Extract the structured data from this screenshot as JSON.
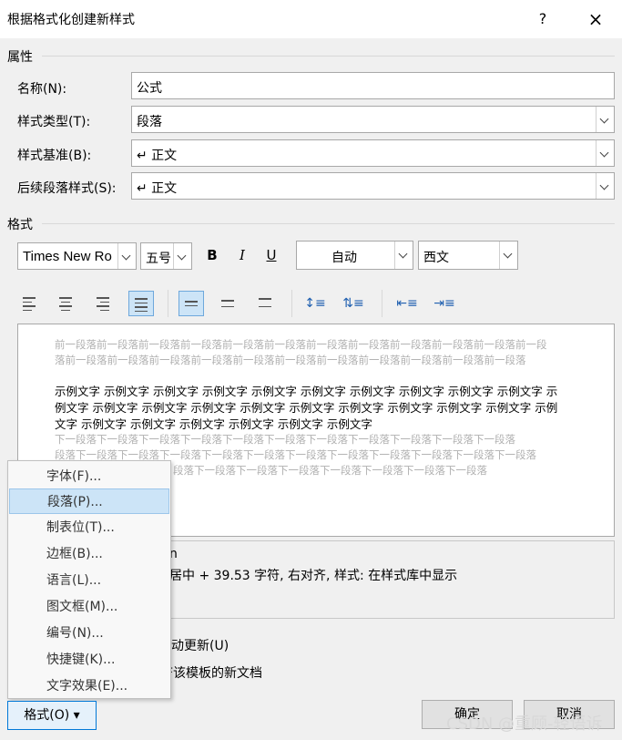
{
  "window": {
    "title": "根据格式化创建新样式",
    "help": "?",
    "close": "×"
  },
  "properties": {
    "section": "属性",
    "name_label": "名称(N):",
    "name_value": "公式",
    "type_label": "样式类型(T):",
    "type_value": "段落",
    "based_label": "样式基准(B):",
    "based_value": "↵ 正文",
    "next_label": "后续段落样式(S):",
    "next_value": "↵ 正文"
  },
  "format": {
    "section": "格式",
    "font": "Times New Ro",
    "size": "五号",
    "bold": "B",
    "italic": "I",
    "underline": "U",
    "color": "自动",
    "script": "西文"
  },
  "preview": {
    "prev_text": "前一段落前一段落前一段落前一段落前一段落前一段落前一段落前一段落前一段落前一段落前一段落前一段落前一段落前一段落前一段落前一段落前一段落前一段落前一段落前一段落前一段落前一段落前一段落",
    "sample_text": "示例文字 示例文字 示例文字 示例文字 示例文字 示例文字 示例文字 示例文字 示例文字 示例文字 示例文字 示例文字 示例文字 示例文字 示例文字 示例文字 示例文字 示例文字 示例文字 示例文字 示例文字 示例文字 示例文字 示例文字 示例文字 示例文字 示例文字",
    "next_line1": "下一段落下一段落下一段落下一段落下一段落下一段落下一段落下一段落下一段落下一段落下一段落",
    "next_line2": "段落下一段落下一段落下一段落下一段落下一段落下一段落下一段落下一段落下一段落下一段落下一段落",
    "next_line3": "段落下一段落下一段落下一段落下一段落下一段落下一段落下一段落"
  },
  "description": {
    "line1": "n",
    "line2": "居中 +  39.53 字符, 右对齐, 样式: 在样式库中显示"
  },
  "checkboxes": {
    "auto_update": "动更新(U)",
    "template": "F该模板的新文档"
  },
  "menu": {
    "items": [
      "字体(F)...",
      "段落(P)...",
      "制表位(T)...",
      "边框(B)...",
      "语言(L)...",
      "图文框(M)...",
      "编号(N)...",
      "快捷键(K)...",
      "文字效果(E)..."
    ]
  },
  "buttons": {
    "format": "格式(O) ▾",
    "ok": "确定",
    "cancel": "取消"
  },
  "watermark": "CSDN @重顾-轻语诉"
}
